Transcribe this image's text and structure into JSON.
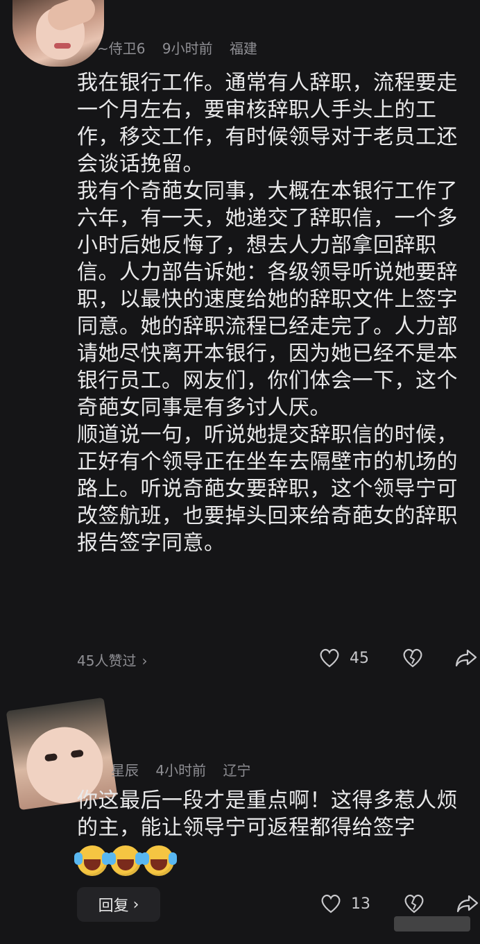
{
  "comment1": {
    "author": "~侍卫6",
    "time": "9小时前",
    "location": "福建",
    "paragraphs": [
      "我在银行工作。通常有人辞职，流程要走一个月左右，要审核辞职人手头上的工作，移交工作，有时候领导对于老员工还会谈话挽留。",
      "我有个奇葩女同事，大概在本银行工作了六年，有一天，她递交了辞职信，一个多小时后她反悔了，想去人力部拿回辞职信。人力部告诉她：各级领导听说她要辞职，以最快的速度给她的辞职文件上签字同意。她的辞职流程已经走完了。人力部请她尽快离开本银行，因为她已经不是本银行员工。网友们，你们体会一下，这个奇葩女同事是有多讨人厌。",
      "顺道说一句，听说她提交辞职信的时候，正好有个领导正在坐车去隔壁市的机场的路上。听说奇葩女要辞职，这个领导宁可改签航班，也要掉头回来给奇葩女的辞职报告签字同意。"
    ],
    "likes_link": "45人赞过",
    "like_count": "45"
  },
  "comment2": {
    "author": "星辰",
    "time": "4小时前",
    "location": "辽宁",
    "text": "你这最后一段才是重点啊！这得多惹人烦的主，能让领导宁可返程都得给签字",
    "emojis": [
      "laugh-cry-emoji",
      "laugh-cry-emoji",
      "laugh-cry-emoji"
    ],
    "reply_label": "回复",
    "like_count": "13"
  },
  "icons": {
    "like": "heart-icon",
    "dislike": "broken-heart-icon",
    "share": "share-arrow-icon",
    "chevron": "chevron-right-icon"
  },
  "colors": {
    "background": "#151517",
    "text": "#e9e9ea",
    "meta": "#8f8f94"
  }
}
